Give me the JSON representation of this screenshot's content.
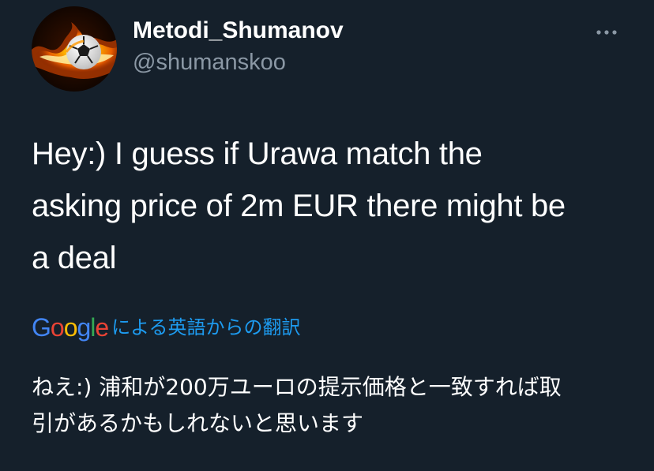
{
  "tweet": {
    "author": {
      "display_name": "Metodi_Shumanov",
      "handle": "@shumanskoo",
      "avatar_icon": "flaming-soccer-ball-avatar"
    },
    "more_icon": "more-options-icon",
    "text_lines": [
      "Hey:) I guess if Urawa match the",
      "asking price of 2m EUR there might be",
      "a deal"
    ],
    "translation": {
      "provider_letters": [
        "G",
        "o",
        "o",
        "g",
        "l",
        "e"
      ],
      "label": "による英語からの翻訳",
      "text_lines": [
        "ねえ:) 浦和が200万ユーロの提示価格と一致すれば取",
        "引があるかもしれないと思います"
      ]
    }
  },
  "colors": {
    "background": "#15202b",
    "primary_text": "#ffffff",
    "secondary_text": "#8b98a5",
    "link": "#1d9bf0",
    "google_blue": "#4285f4",
    "google_red": "#ea4335",
    "google_yellow": "#fbbc05",
    "google_green": "#34a853"
  }
}
